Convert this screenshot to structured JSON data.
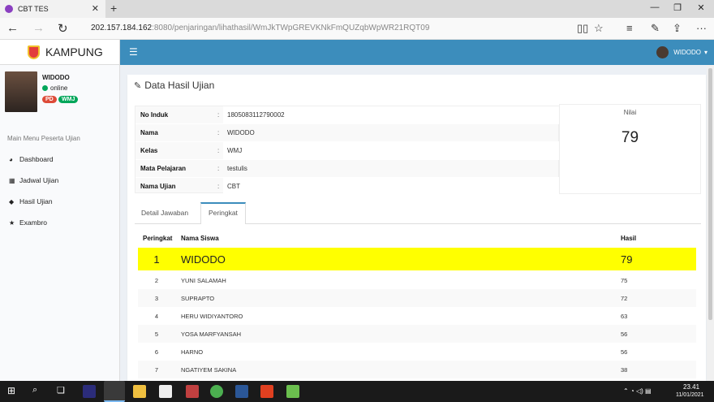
{
  "browser": {
    "tab_title": "CBT TES",
    "url_host": "202.157.184.162",
    "url_rest": ":8080/penjaringan/lihathasil/WmJkTWpGREVKNkFmQUZqbWpWR21RQT09"
  },
  "app": {
    "brand": "KAMPUNG",
    "user_name": "WIDODO",
    "status": "online",
    "badges": [
      "PD",
      "WMJ"
    ],
    "menu_header": "Main Menu Peserta Ujian",
    "menu": [
      {
        "label": "Dashboard",
        "icon": "dashboard-icon"
      },
      {
        "label": "Jadwal Ujian",
        "icon": "calendar-icon"
      },
      {
        "label": "Hasil Ujian",
        "icon": "tags-icon"
      },
      {
        "label": "Exambro",
        "icon": "star-icon"
      }
    ],
    "topbar_user": "WIDODO"
  },
  "panel": {
    "title": "Data Hasil Ujian",
    "info": [
      {
        "label": "No Induk",
        "value": "1805083112790002"
      },
      {
        "label": "Nama",
        "value": "WIDODO"
      },
      {
        "label": "Kelas",
        "value": "WMJ"
      },
      {
        "label": "Mata Pelajaran",
        "value": "testulis"
      },
      {
        "label": "Nama Ujian",
        "value": "CBT"
      }
    ],
    "colon": ":",
    "nilai_label": "Nilai",
    "nilai_value": "79",
    "tabs": [
      "Detail Jawaban",
      "Peringkat"
    ],
    "table_headers": [
      "Peringkat",
      "Nama Siswa",
      "Hasil"
    ],
    "rows": [
      {
        "rank": "1",
        "name": "WIDODO",
        "score": "79"
      },
      {
        "rank": "2",
        "name": "YUNI SALAMAH",
        "score": "75"
      },
      {
        "rank": "3",
        "name": "SUPRAPTO",
        "score": "72"
      },
      {
        "rank": "4",
        "name": "HERU WIDIYANTORO",
        "score": "63"
      },
      {
        "rank": "5",
        "name": "YOSA MARFYANSAH",
        "score": "56"
      },
      {
        "rank": "6",
        "name": "HARNO",
        "score": "56"
      },
      {
        "rank": "7",
        "name": "NGATIYEM SAKINA",
        "score": "38"
      }
    ]
  },
  "taskbar": {
    "time": "23.41",
    "date": "11/01/2021"
  },
  "colors": {
    "topbar": "#3c8dbc",
    "highlight": "#ffff00",
    "online": "#00a65a",
    "badge_pd": "#dd4b39",
    "badge_wmj": "#00a65a"
  }
}
